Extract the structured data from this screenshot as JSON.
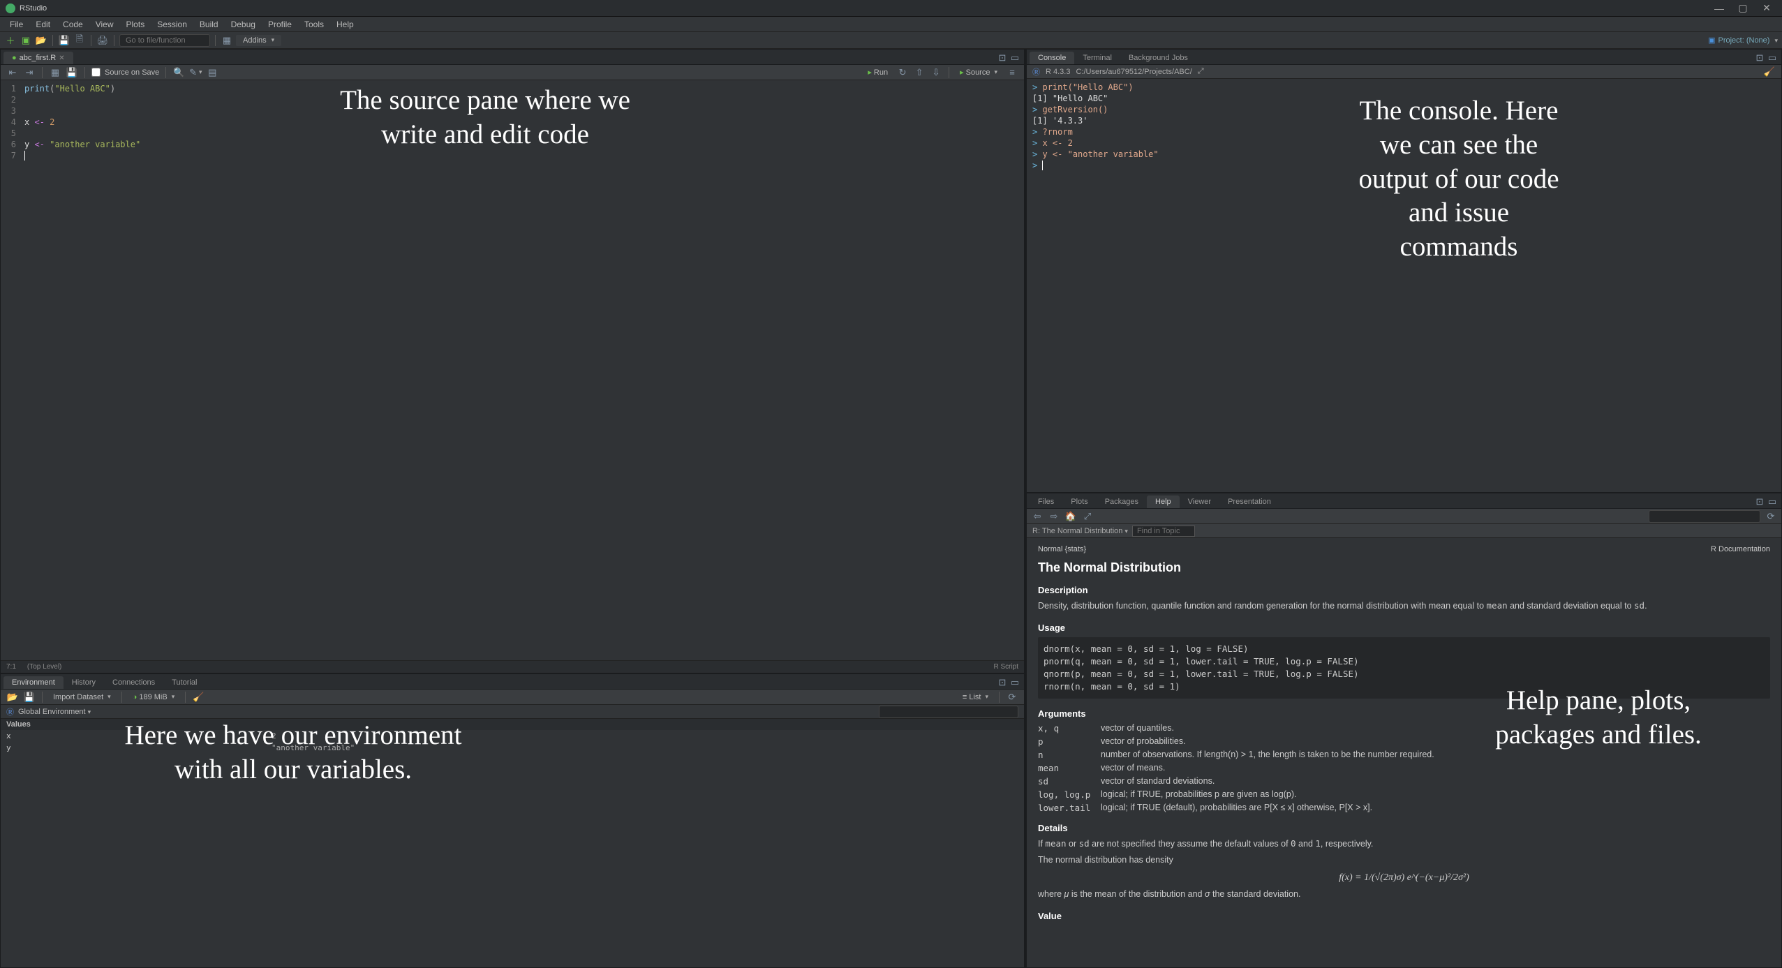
{
  "app_title": "RStudio",
  "window_controls": {
    "min": "—",
    "max": "▢",
    "close": "✕"
  },
  "menus": [
    "File",
    "Edit",
    "Code",
    "View",
    "Plots",
    "Session",
    "Build",
    "Debug",
    "Profile",
    "Tools",
    "Help"
  ],
  "main_toolbar": {
    "goto_placeholder": "Go to file/function",
    "addins": "Addins",
    "project_label": "Project: (None)"
  },
  "source": {
    "tab_name": "abc_first.R",
    "source_on_save": "Source on Save",
    "run_label": "Run",
    "source_label": "Source",
    "line_numbers": [
      "1",
      "2",
      "3",
      "4",
      "5",
      "6",
      "7"
    ],
    "lines": [
      {
        "type": "print",
        "fn": "print",
        "str": "\"Hello ABC\""
      },
      {
        "type": "blank"
      },
      {
        "type": "blank"
      },
      {
        "type": "assign",
        "var": "x",
        "op": "<-",
        "val_num": "2"
      },
      {
        "type": "blank"
      },
      {
        "type": "assign",
        "var": "y",
        "op": "<-",
        "val_str": "\"another variable\""
      },
      {
        "type": "cursor"
      }
    ],
    "status_pos": "7:1",
    "status_scope": "(Top Level)",
    "status_lang": "R Script"
  },
  "environment": {
    "tabs": [
      "Environment",
      "History",
      "Connections",
      "Tutorial"
    ],
    "import_label": "Import Dataset",
    "mem_label": "189 MiB",
    "scope": "Global Environment",
    "list_label": "List",
    "section": "Values",
    "rows": [
      {
        "name": "x",
        "value": "2"
      },
      {
        "name": "y",
        "value": "\"another variable\""
      }
    ]
  },
  "console": {
    "tabs": [
      "Console",
      "Terminal",
      "Background Jobs"
    ],
    "r_version": "R 4.3.3",
    "r_path": "C:/Users/au679512/Projects/ABC/",
    "lines": [
      {
        "prompt": ">",
        "call_fn": "print",
        "arg": "\"Hello ABC\""
      },
      {
        "out": "[1] \"Hello ABC\""
      },
      {
        "prompt": ">",
        "call_fn": "getRversion",
        "arg": ""
      },
      {
        "out": "[1] '4.3.3'"
      },
      {
        "prompt": ">",
        "plain": "?rnorm"
      },
      {
        "prompt": ">",
        "plain": "x <- 2"
      },
      {
        "prompt": ">",
        "plain": "y <- \"another variable\""
      },
      {
        "prompt": ">",
        "plain": ""
      }
    ]
  },
  "help": {
    "tabs": [
      "Files",
      "Plots",
      "Packages",
      "Help",
      "Viewer",
      "Presentation"
    ],
    "topic_crumb": "R: The Normal Distribution",
    "find_placeholder": "Find in Topic",
    "pkg_header_left": "Normal {stats}",
    "pkg_header_right": "R Documentation",
    "title": "The Normal Distribution",
    "sec_desc": "Description",
    "desc_text_a": "Density, distribution function, quantile function and random generation for the normal distribution with mean equal to ",
    "desc_mean": "mean",
    "desc_text_b": " and standard deviation equal to ",
    "desc_sd": "sd",
    "sec_usage": "Usage",
    "usage_code": "dnorm(x, mean = 0, sd = 1, log = FALSE)\npnorm(q, mean = 0, sd = 1, lower.tail = TRUE, log.p = FALSE)\nqnorm(p, mean = 0, sd = 1, lower.tail = TRUE, log.p = FALSE)\nrnorm(n, mean = 0, sd = 1)",
    "sec_args": "Arguments",
    "args": [
      {
        "n": "x, q",
        "d": "vector of quantiles."
      },
      {
        "n": "p",
        "d": "vector of probabilities."
      },
      {
        "n": "n",
        "d": "number of observations. If length(n) > 1, the length is taken to be the number required."
      },
      {
        "n": "mean",
        "d": "vector of means."
      },
      {
        "n": "sd",
        "d": "vector of standard deviations."
      },
      {
        "n": "log, log.p",
        "d": "logical; if TRUE, probabilities p are given as log(p)."
      },
      {
        "n": "lower.tail",
        "d": "logical; if TRUE (default), probabilities are P[X ≤ x] otherwise, P[X > x]."
      }
    ],
    "sec_details": "Details",
    "details_p1_a": "If ",
    "details_p1_b": " or ",
    "details_p1_c": " are not specified they assume the default values of ",
    "details_p1_d": " and ",
    "details_p1_e": ", respectively.",
    "details_mean": "mean",
    "details_sd": "sd",
    "details_0": "0",
    "details_1": "1",
    "details_p2": "The normal distribution has density",
    "details_formula": "f(x) = 1/(√(2π)σ) e^(−(x−μ)²/2σ²)",
    "details_p3_a": "where ",
    "details_mu": "μ",
    "details_p3_b": " is the mean of the distribution and ",
    "details_sigma": "σ",
    "details_p3_c": " the standard deviation.",
    "sec_value": "Value"
  },
  "overlays": {
    "src": "The source pane where we write and edit code",
    "con": "The console. Here we can see the output of our code and issue commands",
    "env": "Here we have our environment with all our variables.",
    "help": "Help pane, plots, packages and files."
  }
}
